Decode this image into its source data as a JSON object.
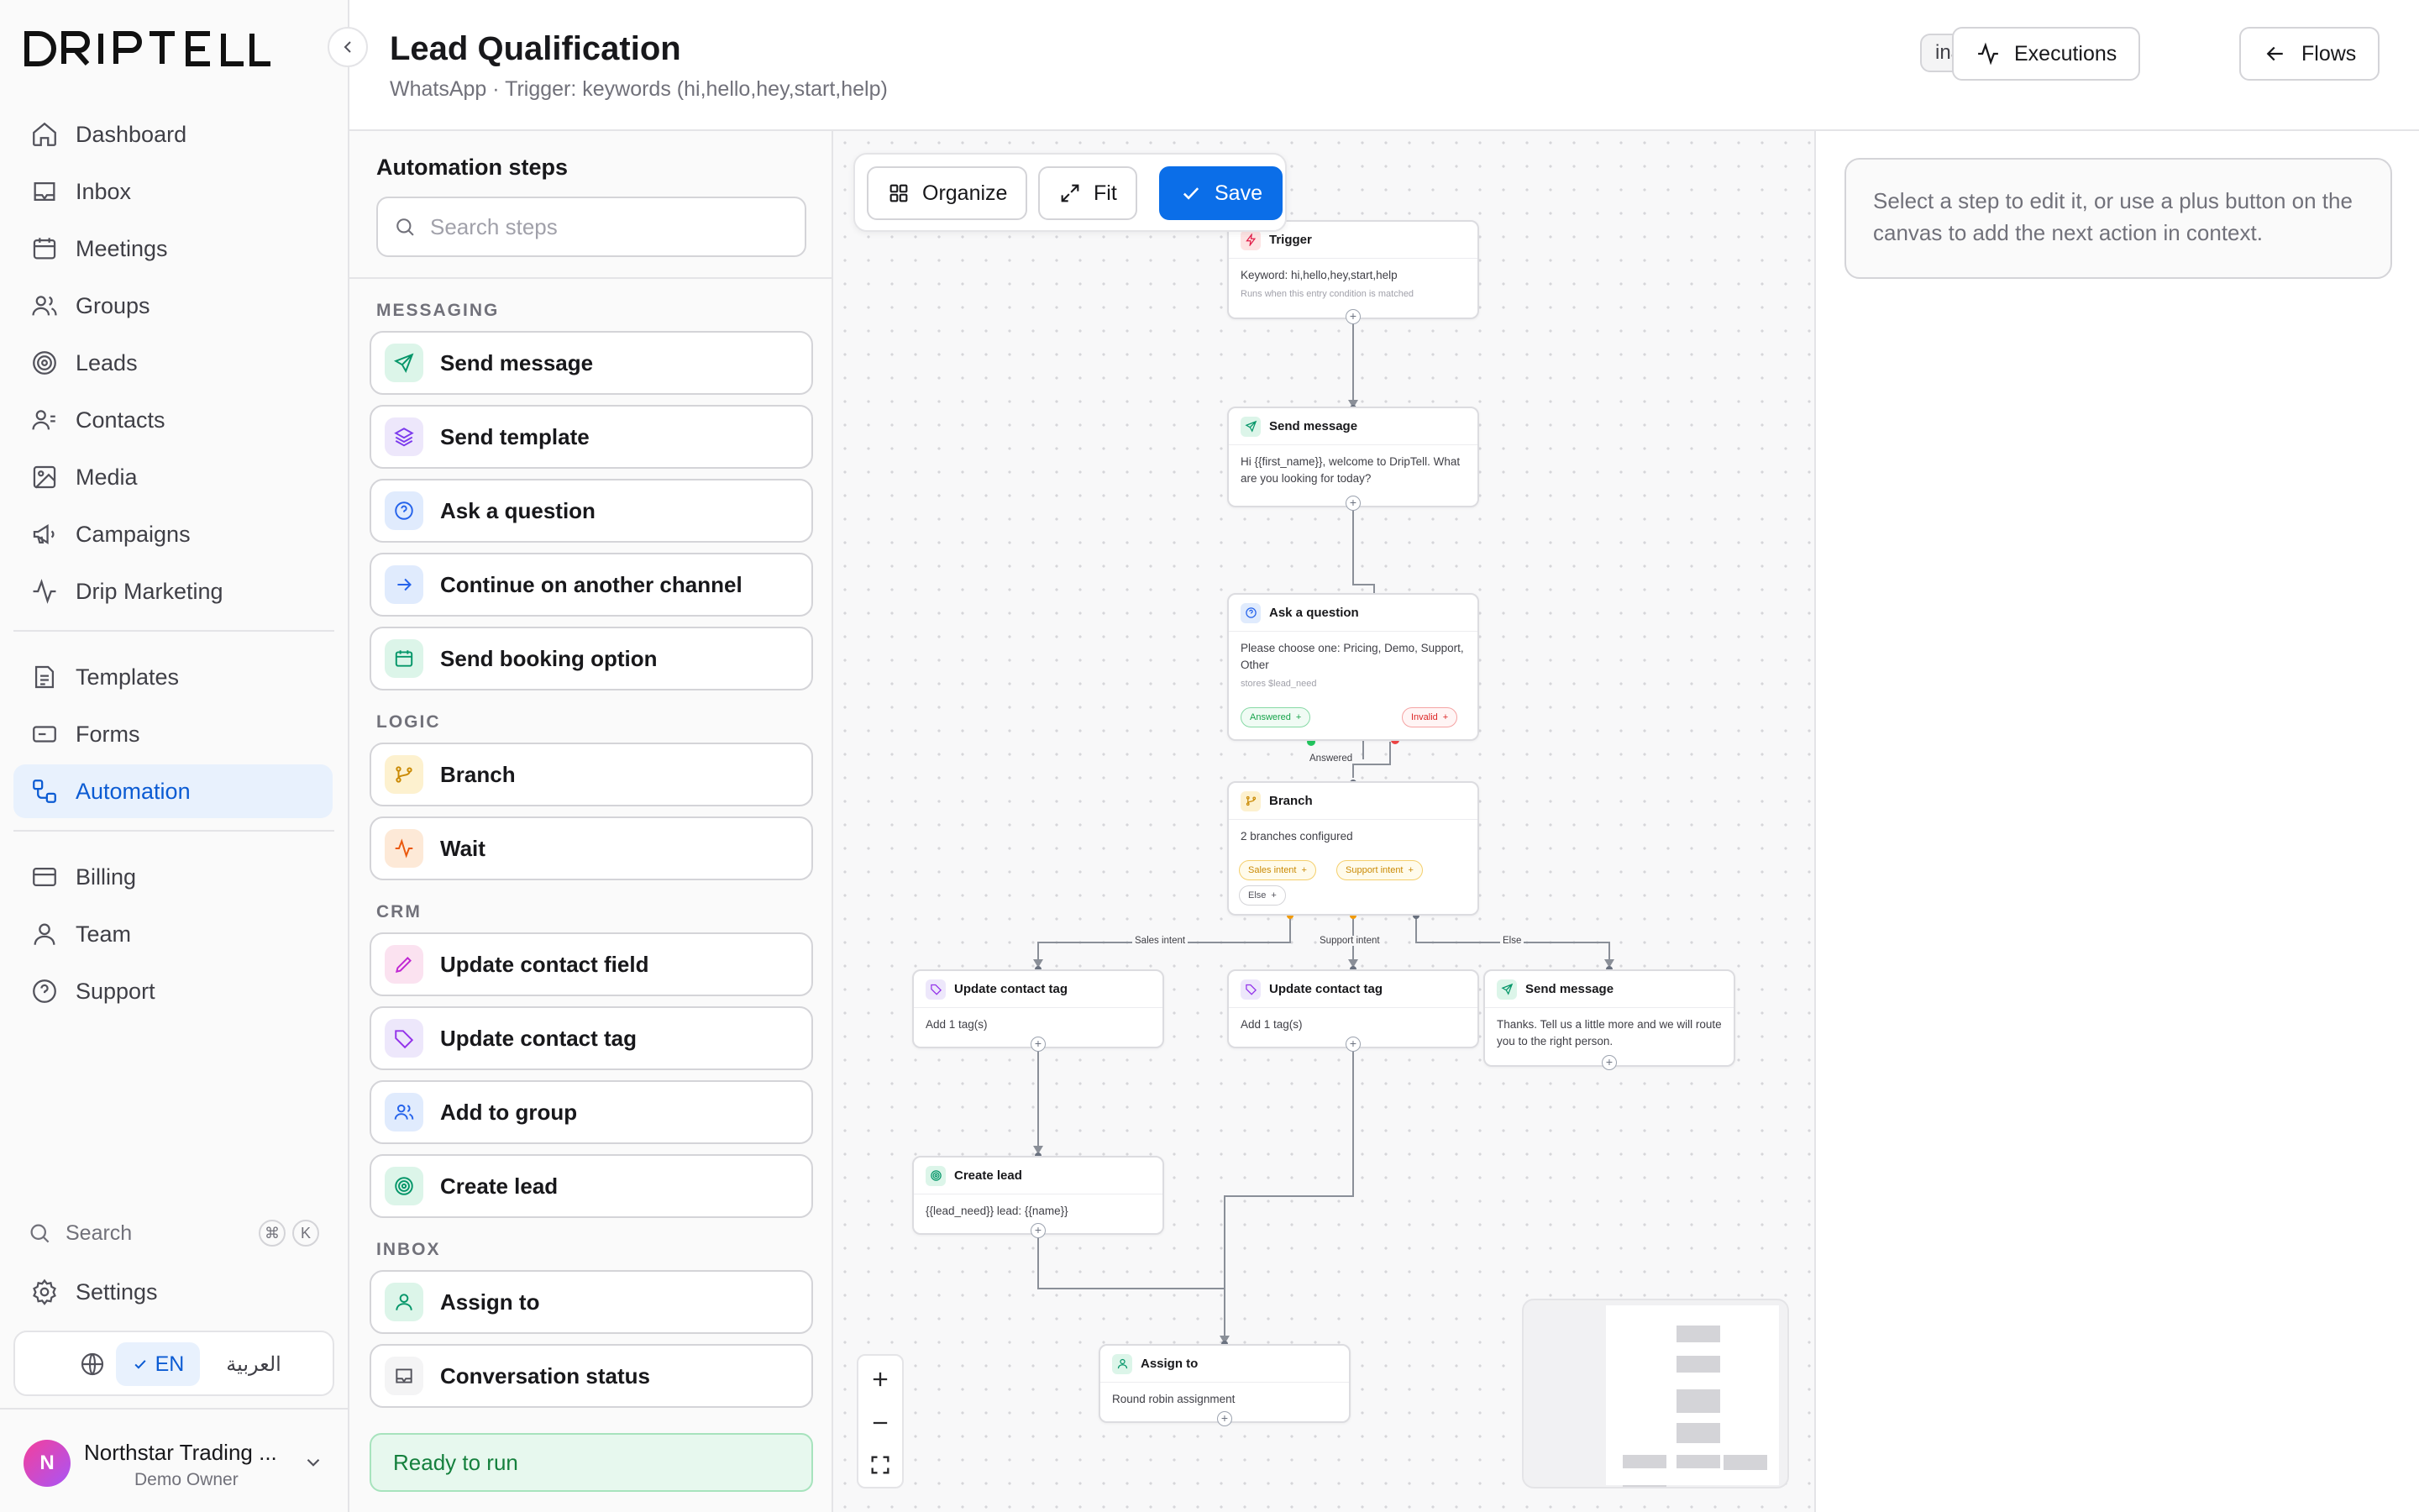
{
  "app": {
    "brand": "DRIPTELL"
  },
  "sidebar": {
    "nav": [
      {
        "label": "Dashboard",
        "icon": "home-icon"
      },
      {
        "label": "Inbox",
        "icon": "inbox-icon"
      },
      {
        "label": "Meetings",
        "icon": "calendar-icon"
      },
      {
        "label": "Groups",
        "icon": "users-icon"
      },
      {
        "label": "Leads",
        "icon": "target-icon"
      },
      {
        "label": "Contacts",
        "icon": "contacts-icon"
      },
      {
        "label": "Media",
        "icon": "image-icon"
      },
      {
        "label": "Campaigns",
        "icon": "megaphone-icon"
      },
      {
        "label": "Drip Marketing",
        "icon": "activity-icon"
      },
      {
        "label": "Templates",
        "icon": "file-icon"
      },
      {
        "label": "Forms",
        "icon": "form-icon"
      },
      {
        "label": "Automation",
        "icon": "workflow-icon",
        "active": true
      },
      {
        "label": "Billing",
        "icon": "card-icon"
      },
      {
        "label": "Team",
        "icon": "user-icon"
      },
      {
        "label": "Support",
        "icon": "help-icon"
      }
    ],
    "search_label": "Search",
    "shortcut": [
      "⌘",
      "K"
    ],
    "settings_label": "Settings",
    "lang": {
      "en": "EN",
      "ar": "العربية"
    },
    "account": {
      "initial": "N",
      "name": "Northstar Trading ...",
      "role": "Demo Owner"
    }
  },
  "header": {
    "title": "Lead Qualification",
    "subtitle": "WhatsApp · Trigger: keywords (hi,hello,hey,start,help)",
    "status": "inactive",
    "executions_label": "Executions",
    "flows_label": "Flows"
  },
  "steps_panel": {
    "title": "Automation steps",
    "search_placeholder": "Search steps",
    "sections": [
      {
        "label": "MESSAGING",
        "items": [
          "Send message",
          "Send template",
          "Ask a question",
          "Continue on another channel",
          "Send booking option"
        ]
      },
      {
        "label": "LOGIC",
        "items": [
          "Branch",
          "Wait"
        ]
      },
      {
        "label": "CRM",
        "items": [
          "Update contact field",
          "Update contact tag",
          "Add to group",
          "Create lead"
        ]
      },
      {
        "label": "INBOX",
        "items": [
          "Assign to",
          "Conversation status"
        ]
      }
    ],
    "ready": "Ready to run"
  },
  "toolbar": {
    "organize": "Organize",
    "fit": "Fit",
    "save": "Save"
  },
  "canvas": {
    "nodes": {
      "trigger": {
        "title": "Trigger",
        "body": "Keyword: hi,hello,hey,start,help",
        "note": "Runs when this entry condition is matched"
      },
      "send1": {
        "title": "Send message",
        "body": "Hi {{first_name}}, welcome to DripTell. What are you looking for today?"
      },
      "ask": {
        "title": "Ask a question",
        "body": "Please choose one: Pricing, Demo, Support, Other",
        "note": "stores $lead_need",
        "answered": "Answered",
        "invalid": "Invalid"
      },
      "branch": {
        "title": "Branch",
        "body": "2 branches configured",
        "sales": "Sales intent",
        "support": "Support intent",
        "else": "Else"
      },
      "tag1": {
        "title": "Update contact tag",
        "body": "Add 1 tag(s)"
      },
      "tag2": {
        "title": "Update contact tag",
        "body": "Add 1 tag(s)"
      },
      "send2": {
        "title": "Send message",
        "body": "Thanks. Tell us a little more and we will route you to the right person."
      },
      "lead": {
        "title": "Create lead",
        "body": "{{lead_need}} lead: {{name}}"
      },
      "assign": {
        "title": "Assign to",
        "body": "Round robin assignment"
      }
    },
    "edge_labels": {
      "answered": "Answered",
      "sales": "Sales intent",
      "support": "Support intent",
      "else": "Else"
    }
  },
  "inspector": {
    "hint": "Select a step to edit it, or use a plus button on the canvas to add the next action in context."
  }
}
